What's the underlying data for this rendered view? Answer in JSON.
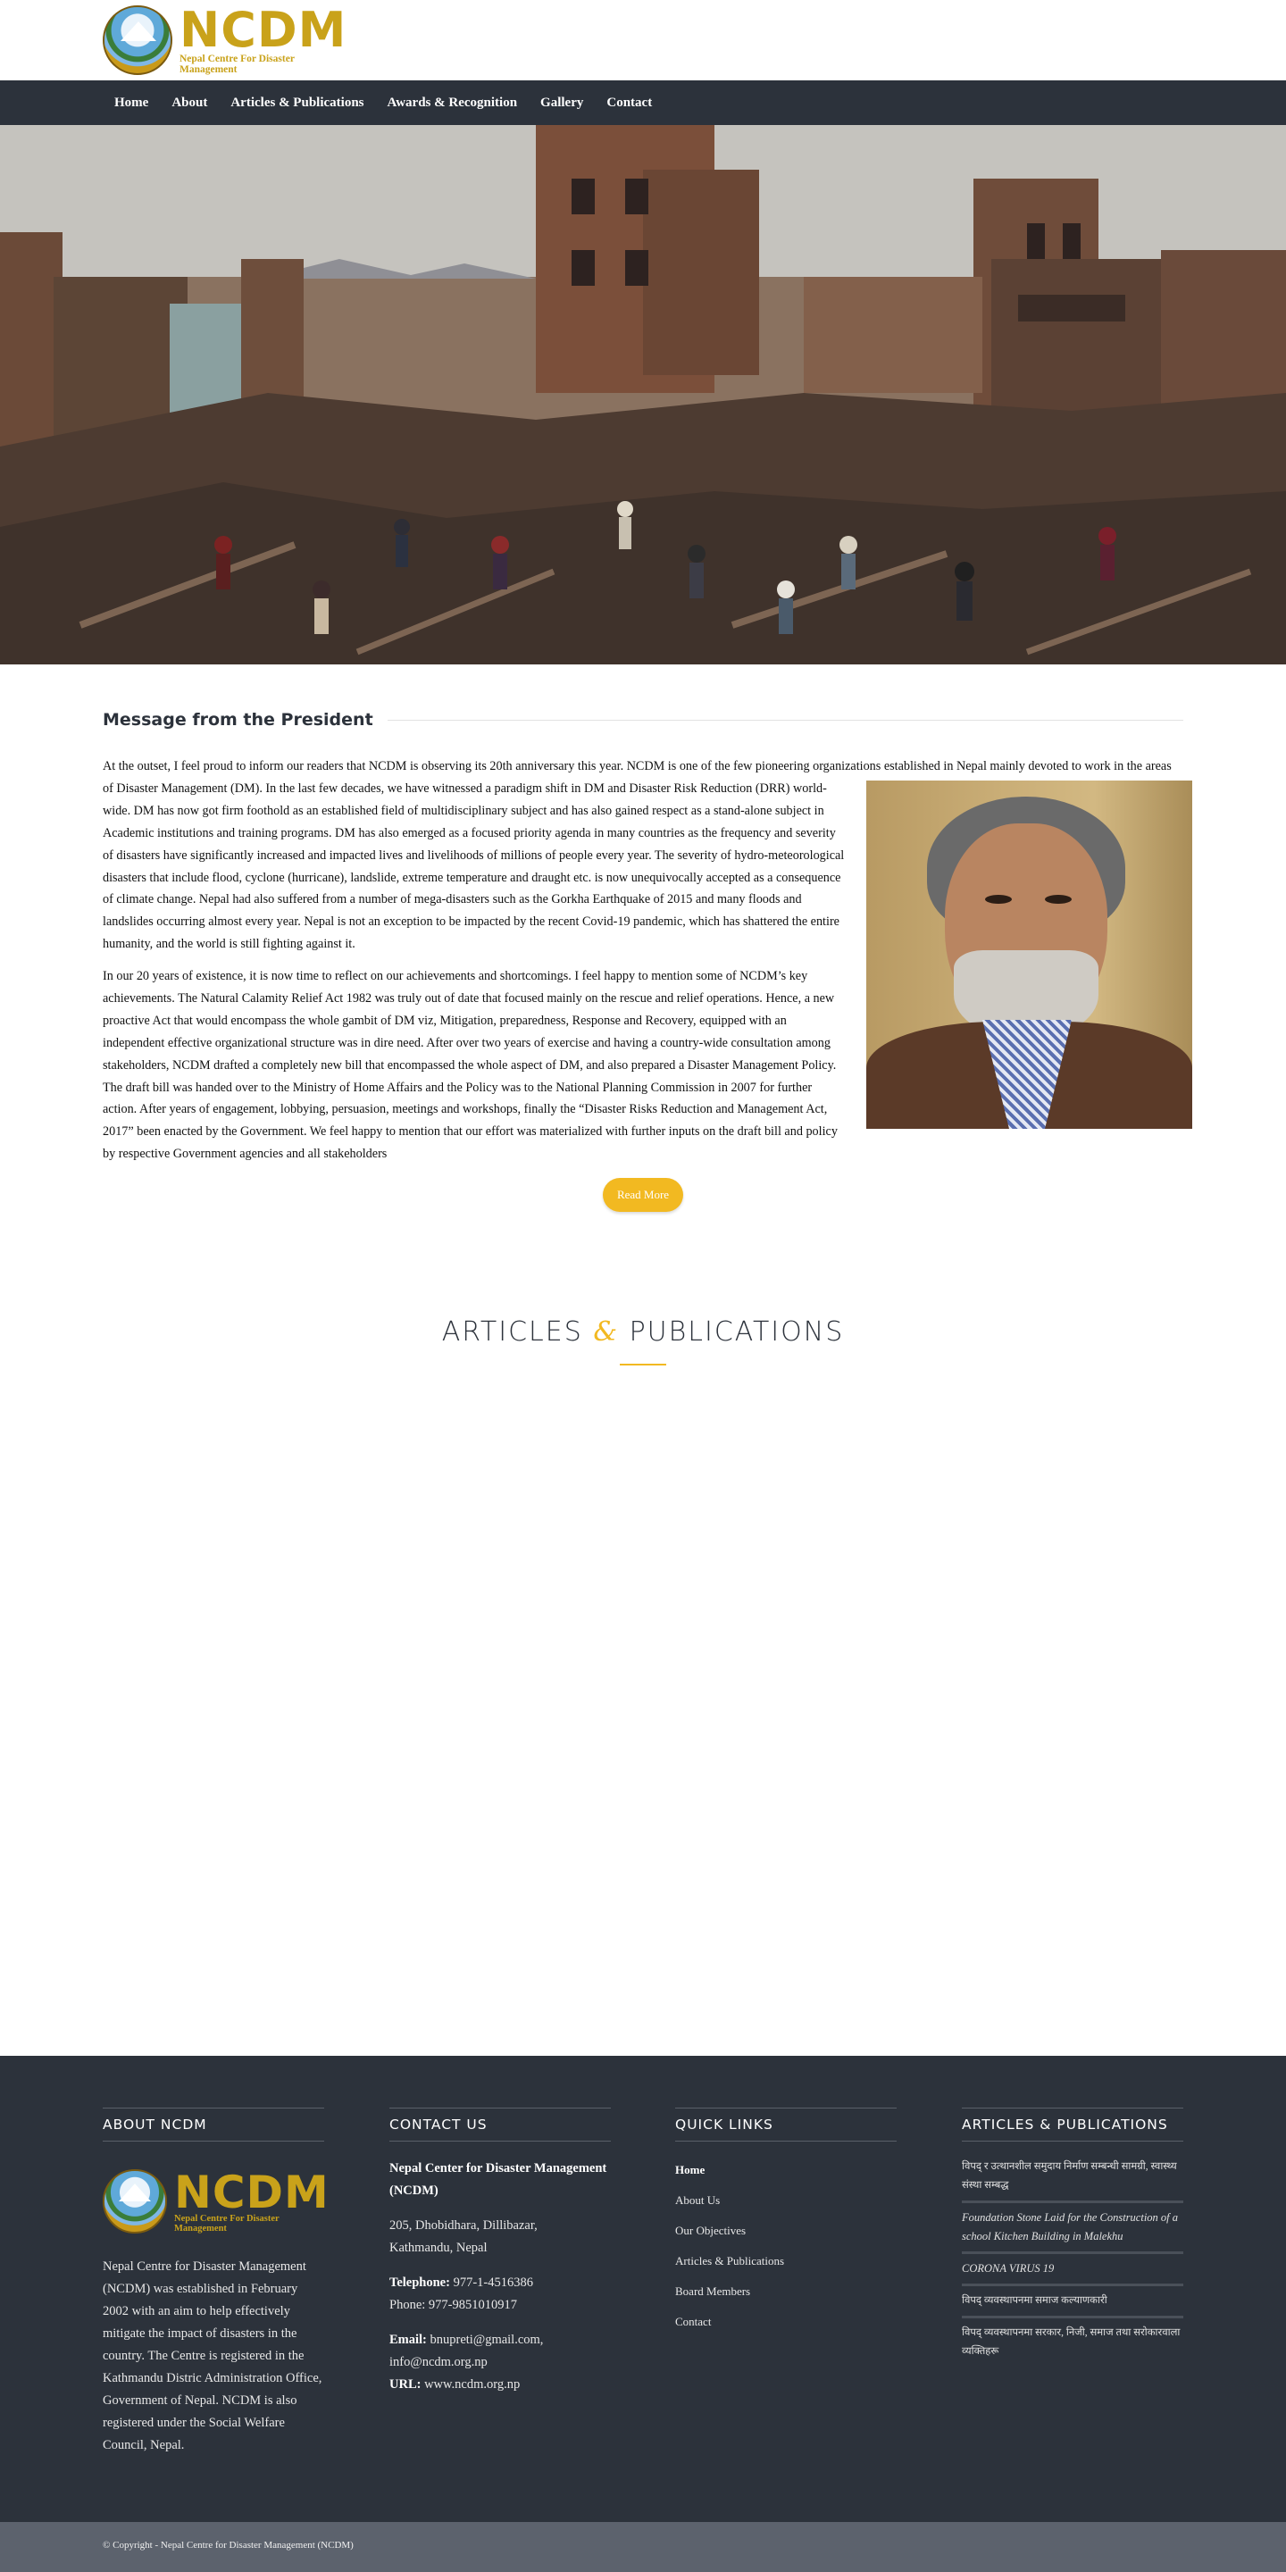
{
  "header": {
    "logo_text": "NCDM",
    "logo_subtitle": "Nepal Centre For Disaster Management"
  },
  "nav": {
    "items": [
      {
        "label": "Home"
      },
      {
        "label": "About"
      },
      {
        "label": "Articles & Publications"
      },
      {
        "label": "Awards & Recognition"
      },
      {
        "label": "Gallery"
      },
      {
        "label": "Contact"
      }
    ]
  },
  "president": {
    "title": "Message from the President",
    "paragraph1": "At the outset, I feel proud to inform our readers that NCDM is observing its 20th anniversary this year.  NCDM is one of the few pioneering organizations established in Nepal mainly devoted to work in the areas of Disaster Management (DM). In the last few decades, we have witnessed a paradigm shift in DM and Disaster Risk Reduction (DRR) world-wide. DM has now got firm foothold as an established field of multidisciplinary subject and has also gained respect as a stand-alone subject in Academic institutions and training programs. DM has also emerged as a focused priority agenda in many countries as the frequency and severity of disasters have significantly increased and impacted lives and livelihoods of millions of people every year. The severity of hydro-meteorological disasters that include flood, cyclone (hurricane), landslide, extreme temperature and draught etc. is now unequivocally accepted as a consequence of climate change. Nepal had also suffered from a number of mega-disasters such as the Gorkha Earthquake of 2015 and many floods and landslides occurring almost every year. Nepal is not an exception to be impacted by the recent Covid-19 pandemic, which has shattered the entire humanity, and the world is still fighting against it.",
    "paragraph2": "In our 20 years of existence, it is now time to reflect on our achievements and shortcomings. I feel happy to mention some of NCDM’s key achievements. The Natural Calamity Relief Act 1982 was truly out of date that focused mainly on the rescue and relief operations. Hence, a new proactive Act that would encompass the whole gambit of DM viz, Mitigation, preparedness, Response and Recovery, equipped with an independent effective organizational structure was in dire need. After over two years of exercise and having a country-wide consultation among stakeholders, NCDM drafted a completely new bill that encompassed the whole aspect of DM, and also prepared a Disaster Management Policy. The draft bill was handed over to the Ministry of Home Affairs and the Policy was to the National Planning Commission in 2007 for further action. After years of engagement, lobbying, persuasion, meetings and workshops, finally the “Disaster Risks Reduction and Management Act, 2017” been enacted by the Government. We feel happy to mention that our effort was materialized with further inputs on the draft bill and policy by respective Government agencies and all stakeholders",
    "read_more": "Read More"
  },
  "articles": {
    "heading_left": "ARTICLES ",
    "heading_amp": "&",
    "heading_right": " PUBLICATIONS"
  },
  "footer": {
    "about": {
      "heading": "ABOUT NCDM",
      "logo_text": "NCDM",
      "logo_subtitle": "Nepal Centre For Disaster Management",
      "text": "Nepal Centre for Disaster Management (NCDM) was established in February 2002 with an aim to help effectively mitigate the impact of disasters in the country. The Centre is registered in the Kathmandu Distric Administration Office, Government of Nepal. NCDM is also registered under the Social Welfare Council, Nepal."
    },
    "contact": {
      "heading": "CONTACT US",
      "org_name": "Nepal Center for Disaster Management (NCDM)",
      "address_line1": "205, Dhobidhara, Dillibazar,",
      "address_line2": "Kathmandu, Nepal",
      "telephone_label": "Telephone:",
      "telephone": " 977-1-4516386",
      "phone": "Phone: 977-9851010917",
      "email_label": "Email:",
      "email": " bnupreti@gmail.com,",
      "email2": "info@ncdm.org.np",
      "url_label": "URL:",
      "url": " www.ncdm.org.np"
    },
    "quick_links": {
      "heading": "QUICK LINKS",
      "items": [
        {
          "label": "Home"
        },
        {
          "label": "About Us"
        },
        {
          "label": "Our Objectives"
        },
        {
          "label": "Articles & Publications"
        },
        {
          "label": "Board Members"
        },
        {
          "label": "Contact"
        }
      ]
    },
    "publications": {
      "heading": "ARTICLES & PUBLICATIONS",
      "items": [
        {
          "label": "विपद् र उत्थानशील समुदाय निर्माण सम्बन्धी सामग्री, स्वास्थ्य संस्था सम्बद्ध"
        },
        {
          "label": "Foundation Stone Laid for the Construction of a school Kitchen Building in Malekhu"
        },
        {
          "label": "CORONA VIRUS 19"
        },
        {
          "label": "विपद् व्यवस्थापनमा समाज कल्याणकारी"
        },
        {
          "label": "विपद् व्यवस्थापनमा सरकार, निजी, समाज तथा सरोकारवाला व्यक्तिहरू"
        }
      ]
    }
  },
  "copyright": "© Copyright - Nepal Centre for Disaster Management (NCDM)"
}
